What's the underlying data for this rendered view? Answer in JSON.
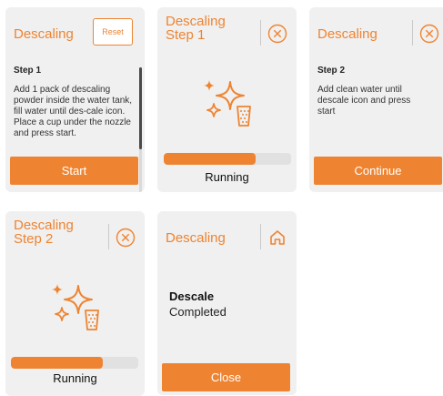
{
  "colors": {
    "accent": "#ee8432",
    "panel": "#f0f0f0",
    "track": "#e1e1e1"
  },
  "screen1": {
    "title": "Descaling",
    "reset_label": "Reset",
    "step_label": "Step 1",
    "step_text": "Add 1 pack of descaling powder inside the water tank, fill water until des-cale icon. Place a cup under the nozzle and press start.",
    "button_label": "Start"
  },
  "screen2": {
    "title": "Descaling\nStep 1",
    "close_icon": "close-circle-icon",
    "status": "Running",
    "progress": 0.72
  },
  "screen3": {
    "title": "Descaling",
    "close_icon": "close-circle-icon",
    "step_label": "Step 2",
    "step_text": "Add clean water until descale icon and press start",
    "button_label": "Continue"
  },
  "screen4": {
    "title": "Descaling\nStep 2",
    "close_icon": "close-circle-icon",
    "status": "Running",
    "progress": 0.72
  },
  "screen5": {
    "title": "Descaling",
    "home_icon": "home-icon",
    "result_title": "Descale",
    "result_subtitle": "Completed",
    "button_label": "Close"
  }
}
